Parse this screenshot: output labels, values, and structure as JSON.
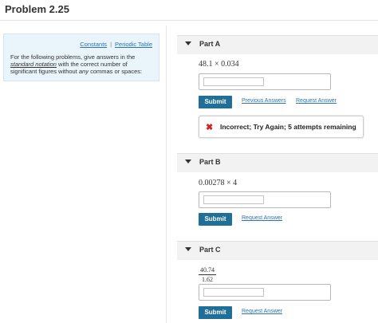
{
  "problem_title": "Problem 2.25",
  "info_panel": {
    "constants_link": "Constants",
    "separator": "|",
    "periodic_table_link": "Periodic Table",
    "text_1": "For the following problems, give answers in the",
    "text_underlined": "standard notation",
    "text_2": " with the correct number of significant figures without ",
    "text_italic": "any",
    "text_3": " commas or spaces:"
  },
  "parts": [
    {
      "label": "Part A",
      "expression": "48.1 × 0.034",
      "input_value": "",
      "submit_label": "Submit",
      "previous_answers_link": "Previous Answers",
      "request_answer_link": "Request Answer",
      "feedback": {
        "icon": "x-icon",
        "message": "Incorrect; Try Again; 5 attempts remaining",
        "color": "#d42020"
      }
    },
    {
      "label": "Part B",
      "expression": "0.00278 × 4",
      "input_value": "",
      "submit_label": "Submit",
      "request_answer_link": "Request Answer"
    },
    {
      "label": "Part C",
      "fraction_numerator": "40.74",
      "fraction_denominator": "1.62",
      "input_value": "",
      "submit_label": "Submit",
      "request_answer_link": "Request Answer"
    }
  ],
  "colors": {
    "submit_button": "#1f6f98",
    "link": "#2a74b4",
    "info_background": "#e9f4fb"
  }
}
